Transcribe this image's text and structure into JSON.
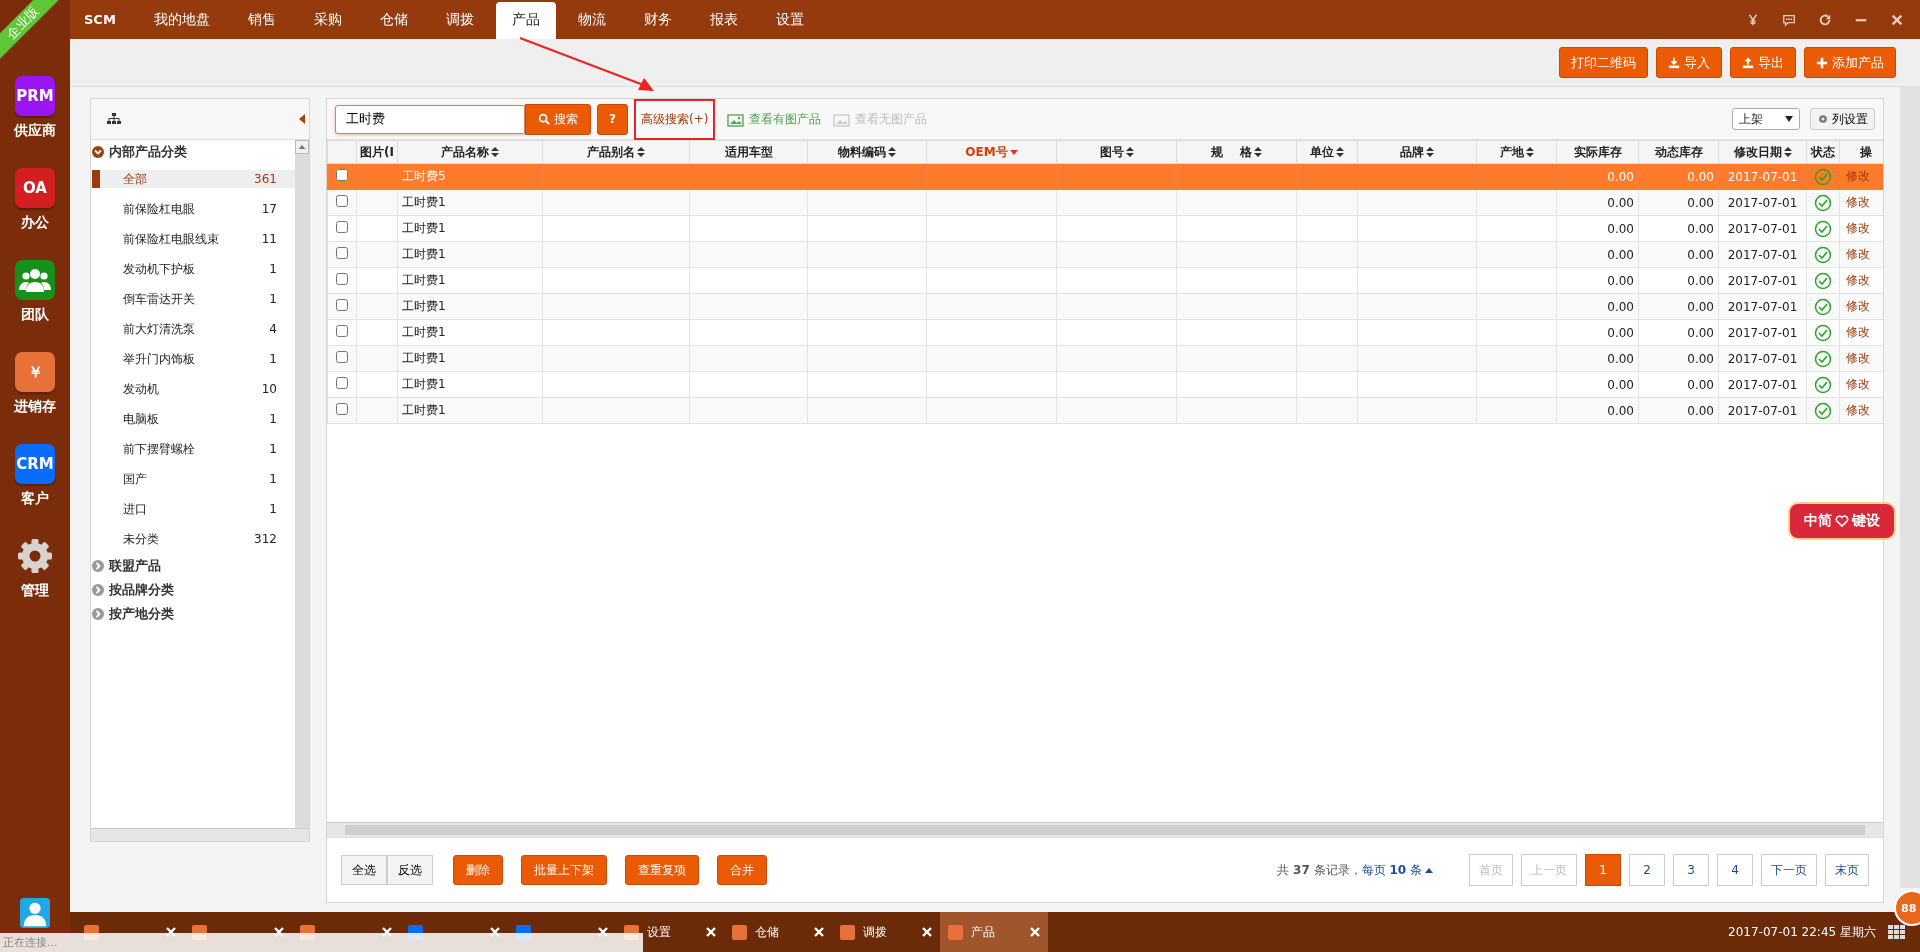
{
  "edition_ribbon": "企业版",
  "apps": [
    {
      "kind": "text",
      "icon_text": "PRM",
      "label": "供应商",
      "color": "#9b14f2"
    },
    {
      "kind": "text",
      "icon_text": "OA",
      "label": "办公",
      "color": "#d31f22"
    },
    {
      "kind": "people",
      "label": "团队",
      "color": "#16921b"
    },
    {
      "kind": "text",
      "icon_text": "￥",
      "label": "进销存",
      "color": "#e8713a"
    },
    {
      "kind": "text",
      "icon_text": "CRM",
      "label": "客户",
      "color": "#0a6cfd"
    },
    {
      "kind": "gear",
      "label": "管理",
      "color": "#d9d3cf"
    }
  ],
  "nav": {
    "logo": "SCM",
    "items": [
      {
        "label": "我的地盘",
        "selected": false
      },
      {
        "label": "销售",
        "selected": false
      },
      {
        "label": "采购",
        "selected": false
      },
      {
        "label": "仓储",
        "selected": false
      },
      {
        "label": "调拨",
        "selected": false
      },
      {
        "label": "产品",
        "selected": true
      },
      {
        "label": "物流",
        "selected": false
      },
      {
        "label": "财务",
        "selected": false
      },
      {
        "label": "报表",
        "selected": false
      },
      {
        "label": "设置",
        "selected": false
      }
    ]
  },
  "toolbar": {
    "buttons": [
      {
        "kind": "plain",
        "label": "打印二维码"
      },
      {
        "kind": "import",
        "label": "导入"
      },
      {
        "kind": "export",
        "label": "导出"
      },
      {
        "kind": "add",
        "label": "添加产品"
      }
    ]
  },
  "tree": {
    "sections": [
      {
        "label": "内部产品分类",
        "expanded": true,
        "children": [
          {
            "label": "全部",
            "count": "361",
            "selected": true
          },
          {
            "label": "前保险杠电眼",
            "count": "17",
            "selected": false
          },
          {
            "label": "前保险杠电眼线束",
            "count": "11",
            "selected": false
          },
          {
            "label": "发动机下护板",
            "count": "1",
            "selected": false
          },
          {
            "label": "倒车雷达开关",
            "count": "1",
            "selected": false
          },
          {
            "label": "前大灯清洗泵",
            "count": "4",
            "selected": false
          },
          {
            "label": "举升门内饰板",
            "count": "1",
            "selected": false
          },
          {
            "label": "发动机",
            "count": "10",
            "selected": false
          },
          {
            "label": "电脑板",
            "count": "1",
            "selected": false
          },
          {
            "label": "前下摆臂螺栓",
            "count": "1",
            "selected": false
          },
          {
            "label": "国产",
            "count": "1",
            "selected": false
          },
          {
            "label": "进口",
            "count": "1",
            "selected": false
          },
          {
            "label": "未分类",
            "count": "312",
            "selected": false
          }
        ]
      },
      {
        "label": "联盟产品",
        "expanded": false
      },
      {
        "label": "按品牌分类",
        "expanded": false
      },
      {
        "label": "按产地分类",
        "expanded": false
      }
    ]
  },
  "search": {
    "value": "工时费",
    "button": "搜索",
    "help": "?",
    "advanced": "高级搜索(+)",
    "advanced_highlighted": true,
    "with_image": "查看有图产品",
    "without_image": "查看无图产品",
    "shelf_select": "上架",
    "column_settings": "列设置"
  },
  "table": {
    "columns": [
      {
        "label": "图片(I",
        "sortable": false,
        "sorted": false
      },
      {
        "label": "产品名称",
        "sortable": true,
        "sorted": false
      },
      {
        "label": "产品别名",
        "sortable": true,
        "sorted": false
      },
      {
        "label": "适用车型",
        "sortable": false,
        "sorted": false
      },
      {
        "label": "物料编码",
        "sortable": true,
        "sorted": false
      },
      {
        "label": "OEM号",
        "sortable": true,
        "sorted": true
      },
      {
        "label": "图号",
        "sortable": true,
        "sorted": false
      },
      {
        "label": "规    格",
        "sortable": true,
        "sorted": false
      },
      {
        "label": "单位",
        "sortable": true,
        "sorted": false
      },
      {
        "label": "品牌",
        "sortable": true,
        "sorted": false
      },
      {
        "label": "产地",
        "sortable": true,
        "sorted": false
      },
      {
        "label": "实际库存",
        "sortable": false,
        "sorted": false
      },
      {
        "label": "动态库存",
        "sortable": false,
        "sorted": false
      },
      {
        "label": "修改日期",
        "sortable": true,
        "sorted": false
      },
      {
        "label": "状态",
        "sortable": false,
        "sorted": false
      },
      {
        "label": "操",
        "sortable": false,
        "sorted": false
      }
    ],
    "rows": [
      {
        "checked": false,
        "selected": true,
        "name": "工时费5",
        "actual_stock": "0.00",
        "dynamic_stock": "0.00",
        "modified": "2017-07-01",
        "status_ok": true,
        "action": "修改"
      },
      {
        "checked": false,
        "selected": false,
        "name": "工时费1",
        "actual_stock": "0.00",
        "dynamic_stock": "0.00",
        "modified": "2017-07-01",
        "status_ok": true,
        "action": "修改"
      },
      {
        "checked": false,
        "selected": false,
        "name": "工时费1",
        "actual_stock": "0.00",
        "dynamic_stock": "0.00",
        "modified": "2017-07-01",
        "status_ok": true,
        "action": "修改"
      },
      {
        "checked": false,
        "selected": false,
        "name": "工时费1",
        "actual_stock": "0.00",
        "dynamic_stock": "0.00",
        "modified": "2017-07-01",
        "status_ok": true,
        "action": "修改"
      },
      {
        "checked": false,
        "selected": false,
        "name": "工时费1",
        "actual_stock": "0.00",
        "dynamic_stock": "0.00",
        "modified": "2017-07-01",
        "status_ok": true,
        "action": "修改"
      },
      {
        "checked": false,
        "selected": false,
        "name": "工时费1",
        "actual_stock": "0.00",
        "dynamic_stock": "0.00",
        "modified": "2017-07-01",
        "status_ok": true,
        "action": "修改"
      },
      {
        "checked": false,
        "selected": false,
        "name": "工时费1",
        "actual_stock": "0.00",
        "dynamic_stock": "0.00",
        "modified": "2017-07-01",
        "status_ok": true,
        "action": "修改"
      },
      {
        "checked": false,
        "selected": false,
        "name": "工时费1",
        "actual_stock": "0.00",
        "dynamic_stock": "0.00",
        "modified": "2017-07-01",
        "status_ok": true,
        "action": "修改"
      },
      {
        "checked": false,
        "selected": false,
        "name": "工时费1",
        "actual_stock": "0.00",
        "dynamic_stock": "0.00",
        "modified": "2017-07-01",
        "status_ok": true,
        "action": "修改"
      },
      {
        "checked": false,
        "selected": false,
        "name": "工时费1",
        "actual_stock": "0.00",
        "dynamic_stock": "0.00",
        "modified": "2017-07-01",
        "status_ok": true,
        "action": "修改"
      }
    ]
  },
  "footer": {
    "select_all": "全选",
    "invert": "反选",
    "actions": [
      "删除",
      "批量上下架",
      "查重复项",
      "合并"
    ],
    "summary": "共 **37** 条记录，",
    "page_size": "每页 **10** 条",
    "pages": [
      {
        "label": "首页",
        "disabled": true,
        "selected": false
      },
      {
        "label": "上一页",
        "disabled": true,
        "selected": false
      },
      {
        "label": "1",
        "disabled": false,
        "selected": true
      },
      {
        "label": "2",
        "disabled": false,
        "selected": false
      },
      {
        "label": "3",
        "disabled": false,
        "selected": false
      },
      {
        "label": "4",
        "disabled": false,
        "selected": false
      },
      {
        "label": "下一页",
        "disabled": false,
        "selected": false
      },
      {
        "label": "末页",
        "disabled": false,
        "selected": false
      }
    ]
  },
  "promo_badge": {
    "left": "中简",
    "right": "键设"
  },
  "corner_badge": "88",
  "taskbar": {
    "tabs": [
      {
        "kind": "obscured",
        "color": "#e8713a",
        "selected": false
      },
      {
        "kind": "obscured",
        "color": "#e8713a",
        "selected": false
      },
      {
        "kind": "obscured",
        "color": "#e8713a",
        "selected": false
      },
      {
        "kind": "obscured",
        "color": "#0a6cfd",
        "selected": false
      },
      {
        "kind": "obscured",
        "color": "#0a6cfd",
        "selected": false
      },
      {
        "kind": "app",
        "label": "设置",
        "color": "#e8713a",
        "selected": false
      },
      {
        "kind": "app",
        "label": "仓储",
        "color": "#e8713a",
        "selected": false
      },
      {
        "kind": "app",
        "label": "调拨",
        "color": "#e8713a",
        "selected": false
      },
      {
        "kind": "app",
        "label": "产品",
        "color": "#e8713a",
        "selected": true
      }
    ],
    "clock": "2017-07-01 22:45 星期六",
    "connection_status": "正在连接..."
  }
}
